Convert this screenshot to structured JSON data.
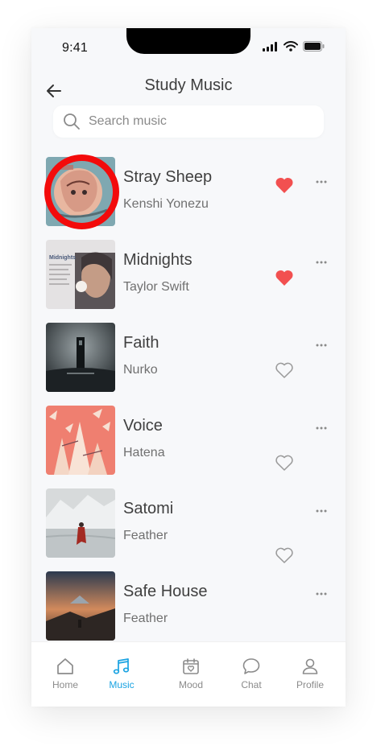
{
  "status": {
    "time": "9:41"
  },
  "header": {
    "title": "Study Music"
  },
  "search": {
    "placeholder": "Search music"
  },
  "colors": {
    "accent": "#1aa3e2",
    "liked": "#f25050",
    "highlight_ring": "#f30b0b"
  },
  "songs": [
    {
      "title": "Stray Sheep",
      "artist": "Kenshi Yonezu",
      "liked": true
    },
    {
      "title": "Midnights",
      "artist": "Taylor Swift",
      "liked": true
    },
    {
      "title": "Faith",
      "artist": "Nurko",
      "liked": false
    },
    {
      "title": "Voice",
      "artist": "Hatena",
      "liked": false
    },
    {
      "title": "Satomi",
      "artist": "Feather",
      "liked": false
    },
    {
      "title": "Safe House",
      "artist": "Feather",
      "liked": null
    }
  ],
  "album_art_text": {
    "midnights": "Midnights"
  },
  "tabs": [
    {
      "label": "Home",
      "icon": "home-icon",
      "active": false
    },
    {
      "label": "Music",
      "icon": "music-icon",
      "active": true
    },
    {
      "label": "Mood",
      "icon": "mood-calendar-icon",
      "active": false
    },
    {
      "label": "Chat",
      "icon": "chat-icon",
      "active": false
    },
    {
      "label": "Profile",
      "icon": "profile-icon",
      "active": false
    }
  ]
}
